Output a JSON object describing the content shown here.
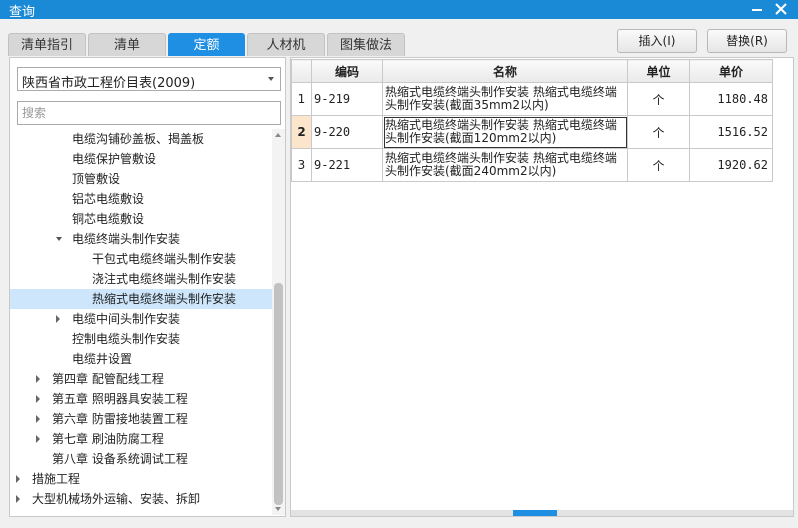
{
  "window": {
    "title": "查询"
  },
  "tabs": [
    {
      "label": "清单指引",
      "active": false
    },
    {
      "label": "清单",
      "active": false
    },
    {
      "label": "定额",
      "active": true
    },
    {
      "label": "人材机",
      "active": false
    },
    {
      "label": "图集做法",
      "active": false
    }
  ],
  "actions": {
    "insert_label": "插入(I)",
    "replace_label": "替换(R)"
  },
  "library": {
    "selected": "陕西省市政工程价目表(2009)"
  },
  "search": {
    "placeholder": "搜索"
  },
  "tree": [
    {
      "label": "电缆沟铺砂盖板、揭盖板",
      "level": 3,
      "expander": "none",
      "selected": false
    },
    {
      "label": "电缆保护管敷设",
      "level": 3,
      "expander": "none",
      "selected": false
    },
    {
      "label": "顶管敷设",
      "level": 3,
      "expander": "none",
      "selected": false
    },
    {
      "label": "铝芯电缆敷设",
      "level": 3,
      "expander": "none",
      "selected": false
    },
    {
      "label": "铜芯电缆敷设",
      "level": 3,
      "expander": "none",
      "selected": false
    },
    {
      "label": "电缆终端头制作安装",
      "level": 3,
      "expander": "expanded",
      "selected": false
    },
    {
      "label": "干包式电缆终端头制作安装",
      "level": 4,
      "expander": "none",
      "selected": false
    },
    {
      "label": "浇注式电缆终端头制作安装",
      "level": 4,
      "expander": "none",
      "selected": false
    },
    {
      "label": "热缩式电缆终端头制作安装",
      "level": 4,
      "expander": "none",
      "selected": true
    },
    {
      "label": "电缆中间头制作安装",
      "level": 3,
      "expander": "collapsed",
      "selected": false
    },
    {
      "label": "控制电缆头制作安装",
      "level": 3,
      "expander": "none",
      "selected": false
    },
    {
      "label": "电缆井设置",
      "level": 3,
      "expander": "none",
      "selected": false
    },
    {
      "label": "第四章 配管配线工程",
      "level": 2,
      "expander": "collapsed",
      "selected": false
    },
    {
      "label": "第五章 照明器具安装工程",
      "level": 2,
      "expander": "collapsed",
      "selected": false
    },
    {
      "label": "第六章 防雷接地装置工程",
      "level": 2,
      "expander": "collapsed",
      "selected": false
    },
    {
      "label": "第七章 刷油防腐工程",
      "level": 2,
      "expander": "collapsed",
      "selected": false
    },
    {
      "label": "第八章 设备系统调试工程",
      "level": 2,
      "expander": "none",
      "selected": false
    },
    {
      "label": "措施工程",
      "level": 1,
      "expander": "collapsed",
      "selected": false
    },
    {
      "label": "大型机械场外运输、安装、拆卸",
      "level": 1,
      "expander": "collapsed",
      "selected": false
    }
  ],
  "grid": {
    "columns": [
      "",
      "编码",
      "名称",
      "单位",
      "单价"
    ],
    "rows": [
      {
        "index": "1",
        "code": "9-219",
        "name": "热缩式电缆终端头制作安装 热缩式电缆终端头制作安装(截面35mm2以内)",
        "unit": "个",
        "price": "1180.48"
      },
      {
        "index": "2",
        "code": "9-220",
        "name": "热缩式电缆终端头制作安装 热缩式电缆终端头制作安装(截面120mm2以内)",
        "unit": "个",
        "price": "1516.52"
      },
      {
        "index": "3",
        "code": "9-221",
        "name": "热缩式电缆终端头制作安装 热缩式电缆终端头制作安装(截面240mm2以内)",
        "unit": "个",
        "price": "1920.62"
      }
    ],
    "current_row": 2
  },
  "colors": {
    "titlebar": "#1a8ad6",
    "active_tab": "#1f8fe3",
    "selected_tree": "#cde6fb",
    "current_row_marker": "#fbe6cc"
  }
}
